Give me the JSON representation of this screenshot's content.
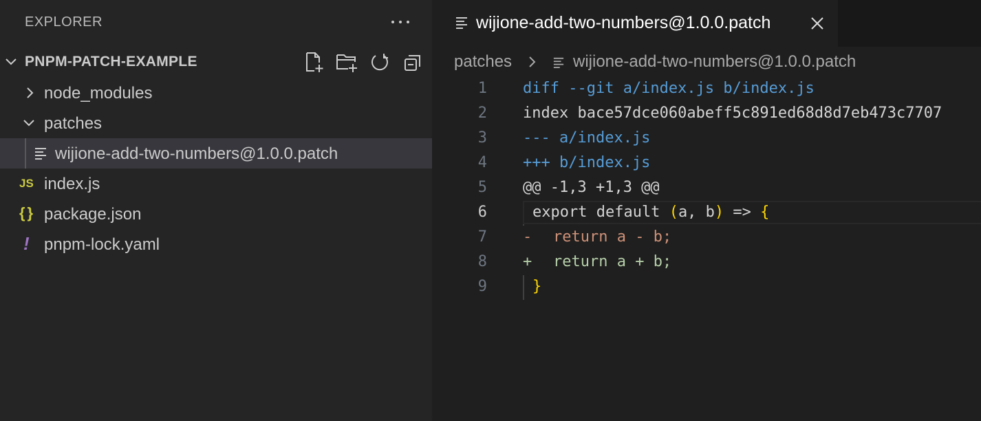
{
  "sidebar": {
    "title": "EXPLORER",
    "more_label": "···",
    "project": "PNPM-PATCH-EXAMPLE",
    "toolbar": [
      "new-file-icon",
      "new-folder-icon",
      "refresh-icon",
      "collapse-all-icon"
    ],
    "tree": [
      {
        "label": "node_modules",
        "type": "folder",
        "expanded": false
      },
      {
        "label": "patches",
        "type": "folder",
        "expanded": true
      },
      {
        "label": "wijione-add-two-numbers@1.0.0.patch",
        "type": "patch-file",
        "selected": true
      },
      {
        "label": "index.js",
        "type": "js-file",
        "icon_text": "JS"
      },
      {
        "label": "package.json",
        "type": "json-file",
        "icon_text": "{}"
      },
      {
        "label": "pnpm-lock.yaml",
        "type": "yaml-file",
        "icon_text": "!"
      }
    ]
  },
  "editor": {
    "tab_label": "wijione-add-two-numbers@1.0.0.patch",
    "breadcrumb": {
      "folder": "patches",
      "file": "wijione-add-two-numbers@1.0.0.patch"
    },
    "current_line": 6,
    "lines": [
      {
        "n": "1",
        "text": "diff --git a/index.js b/index.js"
      },
      {
        "n": "2",
        "text": "index bace57dce060abeff5c891ed68d8d7eb473c7707"
      },
      {
        "n": "3",
        "text": "--- a/index.js"
      },
      {
        "n": "4",
        "text": "+++ b/index.js"
      },
      {
        "n": "5",
        "text": "@@ -1,3 +1,3 @@"
      },
      {
        "n": "6",
        "pre": "export default ",
        "p1": "(",
        "mid": "a, b",
        "p2": ")",
        "post": " => ",
        "brace": "{"
      },
      {
        "n": "7",
        "marker": "-",
        "text": "return a - b;"
      },
      {
        "n": "8",
        "marker": "+",
        "text": "return a + b;"
      },
      {
        "n": "9",
        "brace": "}"
      }
    ]
  },
  "colors": {
    "accent_blue": "#569cd6",
    "removed": "#ce9178",
    "added": "#b5cea8",
    "bracket": "#ffd700",
    "js_icon": "#cbcb41",
    "yaml_icon": "#a074c4"
  }
}
